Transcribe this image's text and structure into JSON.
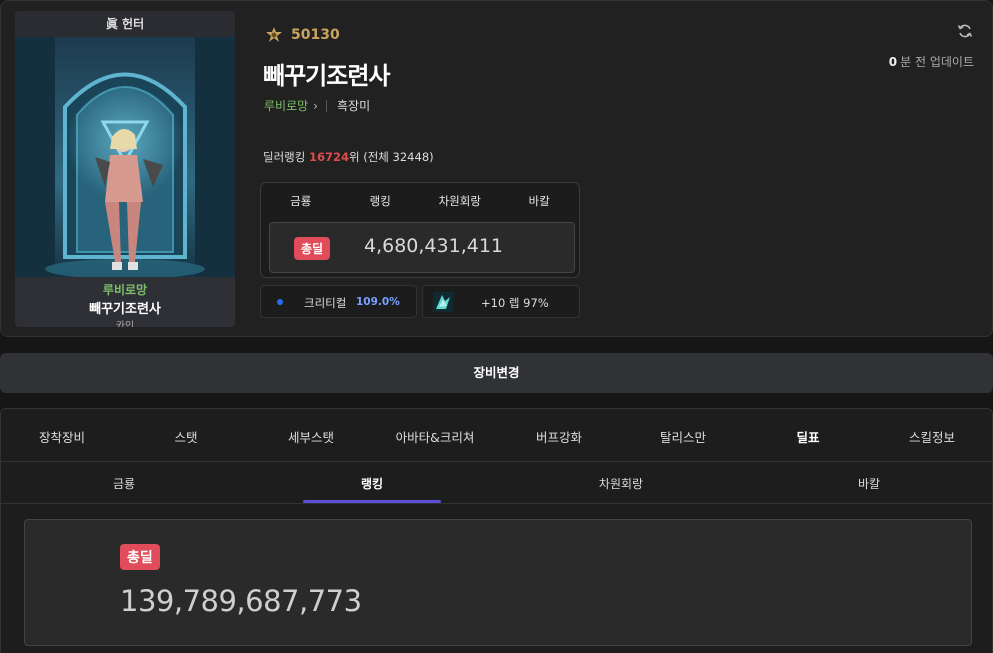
{
  "character": {
    "class_top": "眞 헌터",
    "server_small": "루비로망",
    "name_small": "빼꾸기조련사",
    "sub_small": "카인",
    "fame": "50130",
    "name": "빼꾸기조련사",
    "server": "루비로망",
    "guild": "흑장미"
  },
  "update": {
    "minutes": "0",
    "label": "분 전 업데이트"
  },
  "dealer_ranking": {
    "prefix": "딜러랭킹",
    "rank": "16724",
    "middle": "위 (전체",
    "total": "32448",
    "suffix": ")"
  },
  "rank_box": {
    "tabs": [
      "금룡",
      "랭킹",
      "차원회랑",
      "바칼"
    ],
    "badge": "총딜",
    "value": "4,680,431,411"
  },
  "critical": {
    "label": "크리티컬",
    "value": "109.0%"
  },
  "talisman": {
    "text": "+10 렙 97%"
  },
  "equip_change": "장비변경",
  "main_tabs": [
    "장착장비",
    "스탯",
    "세부스탯",
    "아바타&크리쳐",
    "버프강화",
    "탈리스만",
    "딜표",
    "스킬정보"
  ],
  "active_main_tab": "딜표",
  "sub_tabs": [
    "금룡",
    "랭킹",
    "차원회랑",
    "바칼"
  ],
  "active_sub_tab": "랭킹",
  "damage": {
    "badge": "총딜",
    "value": "139,789,687,773"
  },
  "colors": {
    "accent_underline": "#5b4fd6",
    "badge_red": "#e04c5a",
    "rank_red": "#e04c4c",
    "server_green": "#7fbf6a",
    "crit_blue": "#7aa0ff"
  },
  "icons": {
    "fame": "fame-emblem-icon",
    "refresh": "refresh-icon",
    "chevron": "chevron-right-icon",
    "crit_dot": "dot-icon",
    "talisman": "talisman-icon"
  }
}
